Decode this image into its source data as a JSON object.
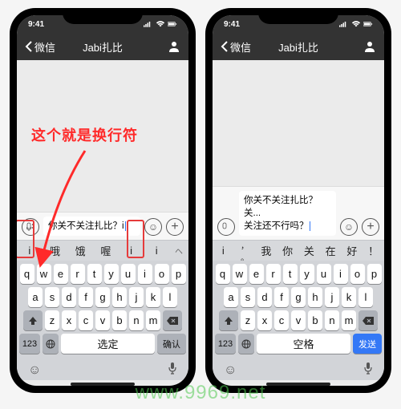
{
  "statusbar": {
    "time": "9:41"
  },
  "titlebar": {
    "back": "微信",
    "title": "Jabi扎比"
  },
  "phone1": {
    "annotation": "这个就是换行符",
    "message": "你关不关注扎比？i",
    "candidates": [
      "i",
      "哦",
      "饿",
      "喔",
      "i",
      "i"
    ],
    "confirm": "选定",
    "return": "确认"
  },
  "phone2": {
    "message_l1": "你关不关注扎比？",
    "message_l2": "关...",
    "message_l3": "关注还不行吗？",
    "candidates": [
      "i",
      "， 。",
      "我",
      "你",
      "关",
      "在",
      "好",
      "！"
    ],
    "space": "空格",
    "return": "发送"
  },
  "keys": {
    "row1": [
      "q",
      "w",
      "e",
      "r",
      "t",
      "y",
      "u",
      "i",
      "o",
      "p"
    ],
    "row2": [
      "a",
      "s",
      "d",
      "f",
      "g",
      "h",
      "j",
      "k",
      "l"
    ],
    "row3": [
      "z",
      "x",
      "c",
      "v",
      "b",
      "n",
      "m"
    ],
    "num": "123"
  },
  "watermark": "www.9969.net"
}
